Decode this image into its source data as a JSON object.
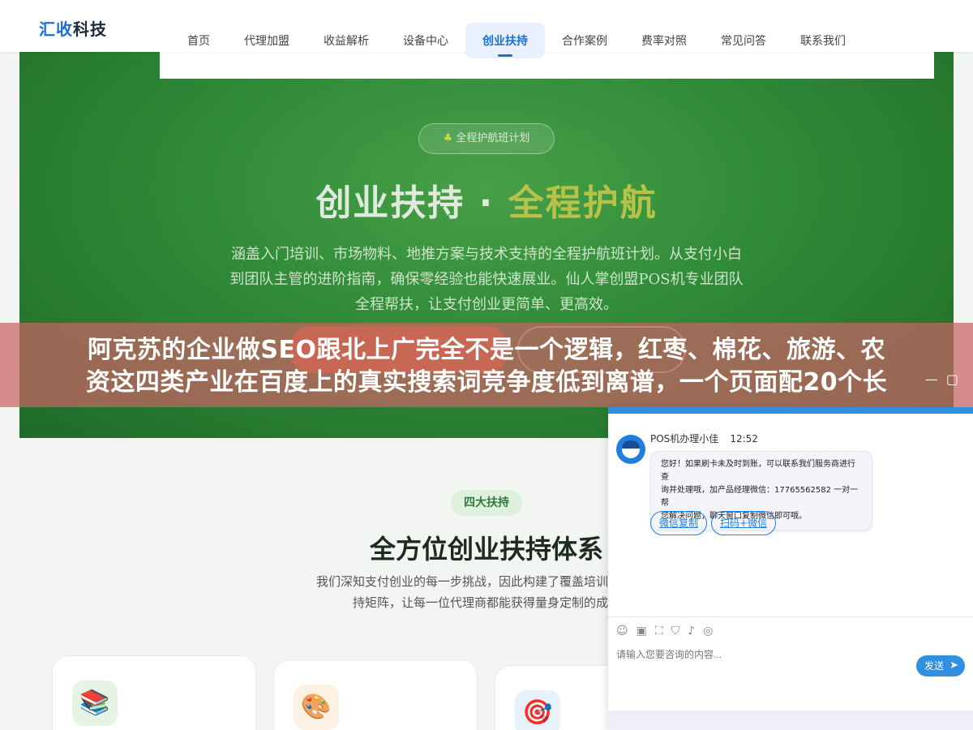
{
  "nav": {
    "logo_part1": "汇收",
    "logo_part2": "科技",
    "items": [
      {
        "label": "首页"
      },
      {
        "label": "代理加盟"
      },
      {
        "label": "收益解析"
      },
      {
        "label": "设备中心"
      },
      {
        "label": "创业扶持"
      },
      {
        "label": "合作案例"
      },
      {
        "label": "费率对照"
      },
      {
        "label": "常见问答"
      },
      {
        "label": "联系我们"
      }
    ],
    "active_item": "创业扶持"
  },
  "hero": {
    "badge_icon": "cactus-icon",
    "badge": "全程护航班计划",
    "title_white": "创业扶持",
    "title_dot": "·",
    "title_gold": "全程护航",
    "description_lines": [
      "涵盖入门培训、市场物料、地推方案与技术支持的全程护航班计划。从支付小白",
      "到团队主管的进阶指南，确保零经验也能快速展业。仙人掌创盟POS机专业团队",
      "全程帮扶，让支付创业更简单、更高效。"
    ]
  },
  "section": {
    "tag": "四大扶持",
    "title": "全方位创业扶持体系",
    "description_lines": [
      "我们深知支付创业的每一步挑战，因此构建了覆盖培训、物料、",
      "持矩阵，让每一位代理商都能获得量身定制的成长"
    ],
    "card_icons": [
      "books-icon",
      "palette-icon",
      "target-icon"
    ]
  },
  "banner": {
    "lines": [
      "阿克苏的企业做SEO跟北上广完全不是一个逻辑，红枣、棉花、旅游、农",
      "资这四类产业在百度上的真实搜索词竞争度低到离谱，一个页面配20个长"
    ]
  },
  "chat": {
    "agent_name": "POS机办理小佳",
    "time": "12:52",
    "message_lines": [
      "您好！如果刷卡未及时到账，可以联系我们服务商进行查",
      "询并处理哦，加产品经理微信：17765562582 一对一帮",
      "您解决问题，聊天窗口复制微信即可哦。"
    ],
    "buttons": [
      {
        "label": "微信复制"
      },
      {
        "label": "扫码+微信"
      }
    ],
    "toolbar_icons": [
      "emoji-icon",
      "image-icon",
      "crop-icon",
      "shield-icon",
      "volume-icon",
      "chat-history-icon"
    ],
    "input_placeholder": "请输入您要咨询的内容...",
    "send_label": "发送"
  },
  "colors": {
    "brand_blue": "#1a6fd6",
    "hero_green": "#2f8a38",
    "hero_gold": "#b6c24a",
    "banner_red": "#c86464",
    "chat_blue": "#2f8fe0"
  }
}
